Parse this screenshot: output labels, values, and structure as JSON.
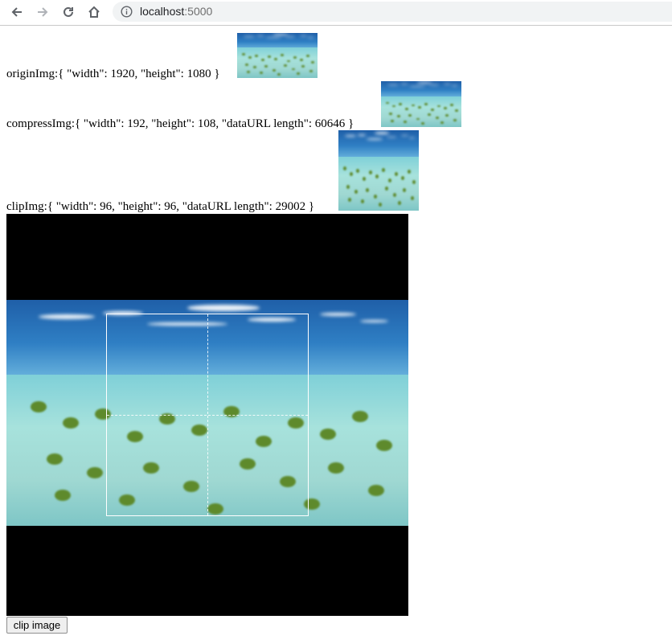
{
  "browser": {
    "url_host": "localhost",
    "url_port": ":5000"
  },
  "rows": {
    "origin_label": "originImg:{ \"width\": 1920, \"height\": 1080 }",
    "compress_label": "compressImg:{ \"width\": 192, \"height\": 108, \"dataURL length\": 60646 }",
    "clip_label": "clipImg:{ \"width\": 96, \"height\": 96, \"dataURL length\": 29002 }"
  },
  "clip_button": "clip image",
  "colors": {
    "canvas_bg": "#000000",
    "sky": "#2f7fc4",
    "sea": "#a7e2dc",
    "plants": "#5e8a2c"
  },
  "icons": [
    "back-arrow-icon",
    "forward-arrow-icon",
    "reload-icon",
    "home-icon",
    "info-icon"
  ]
}
